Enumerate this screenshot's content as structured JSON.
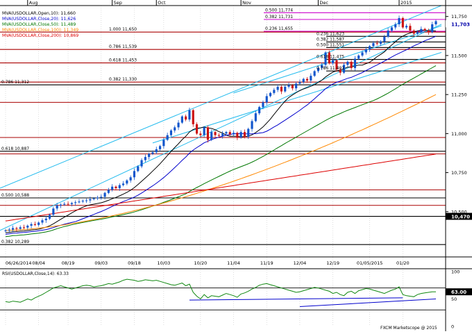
{
  "chart_data": [
    {
      "type": "candlestick",
      "top_axis_labels": [
        "Aug",
        "Sep",
        "Oct",
        "Nov",
        "Dec",
        "2015"
      ],
      "x_tick_labels": [
        "06/26/2014",
        "08/04",
        "08/19",
        "09/03",
        "09/18",
        "10/03",
        "10/20",
        "11/04",
        "11/19",
        "12/04",
        "12/19",
        "01/05/2015",
        "01/20"
      ],
      "y_tick_labels": [
        "11,750",
        "11,500",
        "11,250",
        "11,000",
        "10,750",
        "10,500"
      ],
      "ylim": [
        10210,
        11820
      ],
      "y_ticks": [
        11750,
        11500,
        11250,
        11000,
        10750,
        10500
      ],
      "legend": [
        {
          "label": "MVA(USDOLLAR,Open,10): 11,660",
          "color": "#000000"
        },
        {
          "label": "MVA(USDOLLAR,Close,20): 11,626",
          "color": "#0000cc"
        },
        {
          "label": "MVA(USDOLLAR,Close,50): 11,489",
          "color": "#007700"
        },
        {
          "label": "MVA(USDOLLAR,Close,100): 11,349",
          "color": "#ff8800"
        },
        {
          "label": "MVA(USDOLLAR,Close,200): 10,869",
          "color": "#dd0000"
        }
      ],
      "last_price_label": "11,703",
      "last_price": 11703,
      "support_label": "10,470",
      "support_level": 10470,
      "fib_levels": [
        {
          "label": "0.500 11,774",
          "price": 11774,
          "color": "#cc00cc"
        },
        {
          "label": "0.382 11,731",
          "price": 11731,
          "color": "#cc00cc"
        },
        {
          "label": "0.236 11,655",
          "price": 11655,
          "color": "#cc00cc"
        },
        {
          "label": "1.000 11,650",
          "price": 11650,
          "color": "#aa0000"
        },
        {
          "label": "0.236 11,623",
          "price": 11623,
          "color": "#000000"
        },
        {
          "label": "0.382 11,587",
          "price": 11587,
          "color": "#000000"
        },
        {
          "label": "0.500 11,551",
          "price": 11551,
          "color": "#000000"
        },
        {
          "label": "0.786 11,539",
          "price": 11539,
          "color": "#aa0000"
        },
        {
          "label": "0.618 11,475",
          "price": 11475,
          "color": "#000000"
        },
        {
          "label": "0.618 11,453",
          "price": 11453,
          "color": "#aa0000"
        },
        {
          "label": "0.786 11,401",
          "price": 11401,
          "color": "#000000"
        },
        {
          "label": "0.382 11,330",
          "price": 11330,
          "color": "#aa0000"
        },
        {
          "label": "0.786 11,312",
          "price": 11312,
          "color": "#000000"
        },
        {
          "label": "0.618 10,887",
          "price": 10887,
          "color": "#000000"
        },
        {
          "label": "0.500 10,588",
          "price": 10588,
          "color": "#000000"
        },
        {
          "label": "0.382 10,289",
          "price": 10289,
          "color": "#000000"
        }
      ],
      "extra_levels": [
        11200,
        10975,
        10870,
        10640,
        10540
      ],
      "ohlc_closes": [
        10380,
        10385,
        10395,
        10390,
        10400,
        10398,
        10410,
        10420,
        10415,
        10430,
        10445,
        10455,
        10480,
        10520,
        10540,
        10545,
        10550,
        10548,
        10555,
        10560,
        10565,
        10570,
        10572,
        10580,
        10585,
        10590,
        10595,
        10620,
        10640,
        10660,
        10650,
        10670,
        10680,
        10700,
        10720,
        10760,
        10790,
        10830,
        10850,
        10870,
        10880,
        10900,
        10920,
        10960,
        10990,
        11020,
        11040,
        11070,
        11110,
        11090,
        11150,
        11060,
        11000,
        10990,
        11040,
        10960,
        11010,
        10990,
        10985,
        11000,
        11010,
        10995,
        11005,
        10975,
        11010,
        10980,
        11030,
        11080,
        11130,
        11170,
        11200,
        11240,
        11260,
        11280,
        11300,
        11270,
        11300,
        11310,
        11290,
        11320,
        11330,
        11350,
        11340,
        11370,
        11400,
        11420,
        11440,
        11520,
        11450,
        11470,
        11410,
        11390,
        11440,
        11460,
        11420,
        11480,
        11500,
        11520,
        11540,
        11560,
        11580,
        11575,
        11590,
        11620,
        11660,
        11680,
        11700,
        11740,
        11680,
        11690,
        11660,
        11640,
        11650,
        11670,
        11660,
        11650,
        11700,
        11720
      ],
      "rsi": {
        "label": "RSI(USDOLLAR,Close,14): 63.33",
        "value_label": "63.00",
        "y_tick_labels": [
          "100",
          "50",
          "0"
        ],
        "ylim": [
          0,
          100
        ],
        "levels": [
          70,
          30
        ],
        "values": [
          45,
          44,
          46,
          45,
          44,
          47,
          50,
          48,
          52,
          55,
          58,
          62,
          66,
          70,
          72,
          74,
          72,
          70,
          68,
          70,
          72,
          74,
          75,
          74,
          72,
          73,
          74,
          76,
          78,
          77,
          79,
          81,
          84,
          86,
          85,
          84,
          82,
          83,
          85,
          84,
          83,
          84,
          82,
          80,
          78,
          76,
          75,
          77,
          79,
          74,
          77,
          62,
          55,
          50,
          58,
          52,
          56,
          55,
          54,
          57,
          60,
          58,
          56,
          53,
          59,
          61,
          64,
          68,
          71,
          75,
          77,
          78,
          76,
          74,
          72,
          70,
          68,
          66,
          64,
          62,
          63,
          65,
          67,
          69,
          71,
          70,
          68,
          66,
          64,
          60,
          62,
          58,
          56,
          62,
          64,
          60,
          65,
          67,
          69,
          68,
          66,
          64,
          62,
          60,
          63,
          66,
          68,
          72,
          58,
          56,
          55,
          54,
          58,
          60,
          61,
          62,
          63,
          63
        ]
      },
      "watermark": "FXCM Marketscope @ 2015"
    }
  ]
}
